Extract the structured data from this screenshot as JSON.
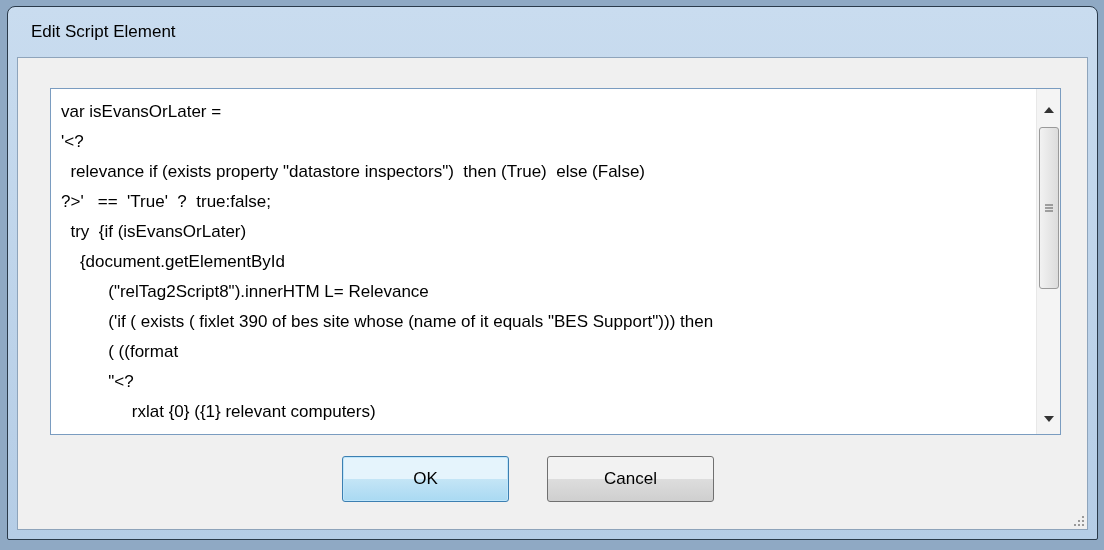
{
  "window": {
    "title": "Edit Script Element"
  },
  "editor": {
    "lines": [
      "var isEvansOrLater =",
      "'<?",
      "  relevance if (exists property \"datastore inspectors\")  then (True)  else (False)",
      "?>'   ==  'True'  ?  true:false;",
      "  try  {if (isEvansOrLater)",
      "    {document.getElementById",
      "          (\"relTag2Script8\").innerHTM L= Relevance",
      "          ('if ( exists ( fixlet 390 of bes site whose (name of it equals \"BES Support\"))) then",
      "          ( ((format",
      "          \"<?",
      "               rxlat {0} ({1} relevant computers)"
    ]
  },
  "buttons": [
    {
      "label": "OK",
      "default": true
    },
    {
      "label": "Cancel",
      "default": false
    }
  ]
}
